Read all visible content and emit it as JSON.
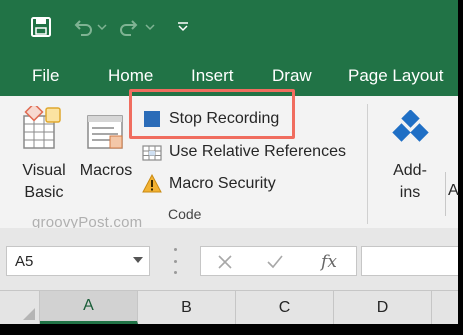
{
  "qat": {
    "icons": [
      "save-icon",
      "undo-icon",
      "dropdown-icon",
      "redo-icon",
      "dropdown-icon",
      "customize-icon"
    ]
  },
  "tabs": [
    "File",
    "Home",
    "Insert",
    "Draw",
    "Page Layout"
  ],
  "ribbon": {
    "visual_basic_label": "Visual Basic",
    "visual_basic_line1": "Visual",
    "visual_basic_line2": "Basic",
    "macros_label": "Macros",
    "stop_recording_label": "Stop Recording",
    "relative_references_label": "Use Relative References",
    "macro_security_label": "Macro Security",
    "group_label": "Code",
    "addins_line1": "Add-",
    "addins_line2": "ins",
    "next_group_partial": "A"
  },
  "watermark": "groovyPost.com",
  "formula_bar": {
    "name_box_value": "A5",
    "fx_label": "fx",
    "formula_value": ""
  },
  "columns": [
    "A",
    "B",
    "C",
    "D"
  ],
  "colors": {
    "accent": "#217346",
    "highlight": "#f06d5f",
    "stop_square": "#2b6cb8",
    "addins_blue": "#1f6fc5"
  }
}
